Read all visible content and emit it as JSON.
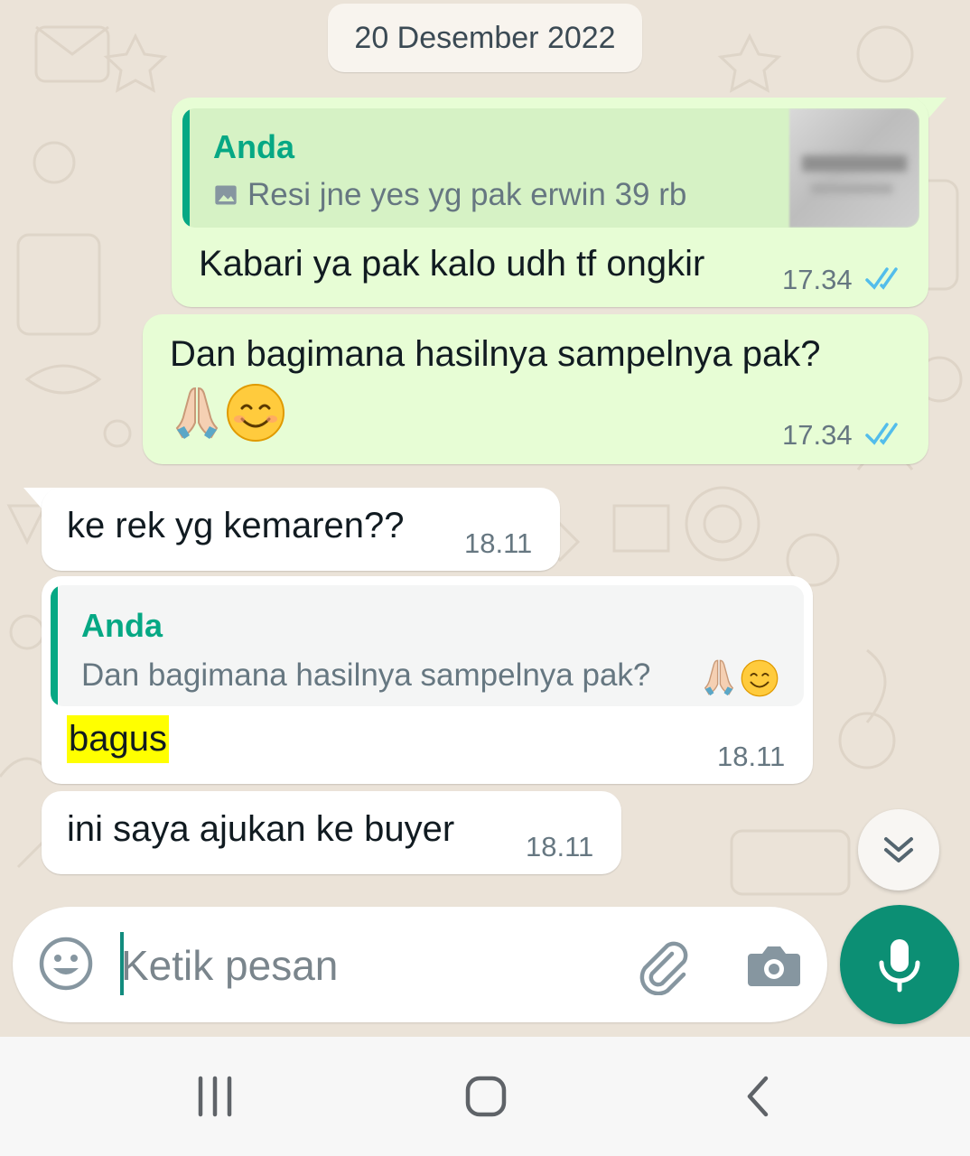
{
  "date_separator": "20 Desember 2022",
  "messages": [
    {
      "direction": "out",
      "quote": {
        "author": "Anda",
        "text": "Resi jne yes yg pak erwin 39 rb",
        "has_image": true
      },
      "text": "Kabari ya pak kalo udh tf ongkir",
      "time": "17.34",
      "status": "read"
    },
    {
      "direction": "out",
      "text": "Dan bagimana hasilnya sampelnya pak?",
      "emoji": [
        "folded-hands",
        "smiling-face"
      ],
      "time": "17.34",
      "status": "read"
    },
    {
      "direction": "in",
      "text": "ke rek yg kemaren??",
      "time": "18.11"
    },
    {
      "direction": "in",
      "quote": {
        "author": "Anda",
        "text": "Dan bagimana hasilnya sampelnya pak?"
      },
      "text": "bagus",
      "highlight": "#ffff00",
      "time": "18.11"
    },
    {
      "direction": "in",
      "text": "ini saya ajukan ke buyer",
      "time": "18.11"
    }
  ],
  "composer": {
    "placeholder": "Ketik pesan",
    "value": "",
    "icons": [
      "emoji-icon",
      "attach-icon",
      "camera-icon",
      "mic-icon"
    ]
  },
  "scroll_down_icon": "double-chevron-down-icon",
  "navigation": [
    "recent-apps",
    "home",
    "back"
  ],
  "colors": {
    "outgoing_bubble": "#e7fdd5",
    "incoming_bubble": "#ffffff",
    "accent": "#06a884",
    "read_ticks": "#53bdeb",
    "mic_button": "#0c8f74",
    "chat_background": "#ebe3d8"
  }
}
